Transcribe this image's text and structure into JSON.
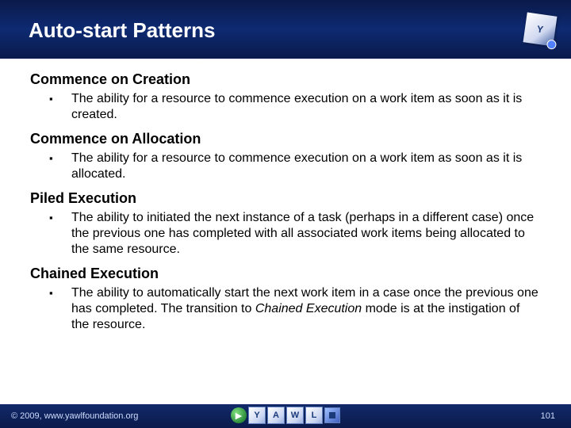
{
  "slide": {
    "title": "Auto-start Patterns",
    "sections": [
      {
        "heading": "Commence on Creation",
        "bullet": "The ability for a resource to commence execution on a work item as soon as it is created."
      },
      {
        "heading": "Commence on Allocation",
        "bullet": "The ability for a resource to commence execution on a work item as soon as it is allocated."
      },
      {
        "heading": "Piled Execution",
        "bullet": "The ability to initiated the next instance of a task (perhaps in a different case) once the previous one has completed with all associated work items being allocated to the same resource."
      },
      {
        "heading": "Chained Execution",
        "bullet_html": "The ability to automatically start the next work item in a case once the previous one has completed. The transition to <i>Chained Execution</i> mode is at the instigation of the resource."
      }
    ]
  },
  "footer": {
    "copyright": "© 2009, www.yawlfoundation.org",
    "page": "101",
    "logo_letters": [
      "Y",
      "A",
      "W",
      "L"
    ]
  },
  "logo_text": "Y"
}
